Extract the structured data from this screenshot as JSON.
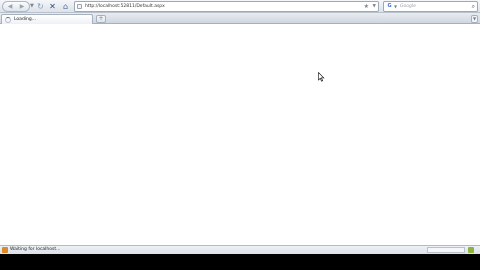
{
  "browser": {
    "nav": {
      "back_icon": "back-arrow-icon",
      "forward_icon": "forward-arrow-icon",
      "history_dropdown_icon": "chevron-down-icon",
      "reload_icon": "reload-icon",
      "stop_icon": "stop-icon",
      "home_icon": "home-icon"
    },
    "address_bar": {
      "url": "http://localhost:52811/Default.aspx",
      "bookmark_icon": "star-icon",
      "dropdown_icon": "chevron-down-icon"
    },
    "search_bar": {
      "engine_icon": "google-icon",
      "placeholder": "Google",
      "go_icon": "magnifier-icon"
    },
    "tabs": [
      {
        "label": "Loading...",
        "state": "loading"
      }
    ],
    "new_tab_label": "+",
    "status_bar": {
      "text": "Waiting for localhost..."
    }
  },
  "colors": {
    "toolbar": "#dde3ea",
    "content": "#ffffff",
    "taskbar": "#000000"
  }
}
